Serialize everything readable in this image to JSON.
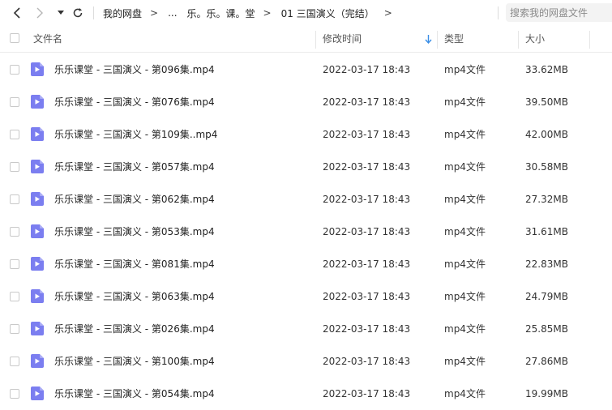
{
  "toolbar": {
    "back_icon": "chevron-left-icon",
    "forward_icon": "chevron-right-icon",
    "history_icon": "caret-down-icon",
    "refresh_icon": "refresh-icon"
  },
  "breadcrumb": {
    "items": [
      "我的网盘",
      "...",
      "乐。乐。课。堂",
      "01 三国演义（完结）"
    ],
    "separator": ">"
  },
  "search": {
    "placeholder": "搜索我的网盘文件"
  },
  "table": {
    "columns": {
      "name": "文件名",
      "time": "修改时间",
      "type": "类型",
      "size": "大小"
    },
    "sort_indicator": "↓",
    "rows": [
      {
        "name": "乐乐课堂 - 三国演义 - 第096集.mp4",
        "time": "2022-03-17 18:43",
        "type": "mp4文件",
        "size": "33.62MB"
      },
      {
        "name": "乐乐课堂 - 三国演义 - 第076集.mp4",
        "time": "2022-03-17 18:43",
        "type": "mp4文件",
        "size": "39.50MB"
      },
      {
        "name": "乐乐课堂 - 三国演义 - 第109集..mp4",
        "time": "2022-03-17 18:43",
        "type": "mp4文件",
        "size": "42.00MB"
      },
      {
        "name": "乐乐课堂 - 三国演义 - 第057集.mp4",
        "time": "2022-03-17 18:43",
        "type": "mp4文件",
        "size": "30.58MB"
      },
      {
        "name": "乐乐课堂 - 三国演义 - 第062集.mp4",
        "time": "2022-03-17 18:43",
        "type": "mp4文件",
        "size": "27.32MB"
      },
      {
        "name": "乐乐课堂 - 三国演义 - 第053集.mp4",
        "time": "2022-03-17 18:43",
        "type": "mp4文件",
        "size": "31.61MB"
      },
      {
        "name": "乐乐课堂 - 三国演义 - 第081集.mp4",
        "time": "2022-03-17 18:43",
        "type": "mp4文件",
        "size": "22.83MB"
      },
      {
        "name": "乐乐课堂 - 三国演义 - 第063集.mp4",
        "time": "2022-03-17 18:43",
        "type": "mp4文件",
        "size": "24.79MB"
      },
      {
        "name": "乐乐课堂 - 三国演义 - 第026集.mp4",
        "time": "2022-03-17 18:43",
        "type": "mp4文件",
        "size": "25.85MB"
      },
      {
        "name": "乐乐课堂 - 三国演义 - 第100集.mp4",
        "time": "2022-03-17 18:43",
        "type": "mp4文件",
        "size": "27.86MB"
      },
      {
        "name": "乐乐课堂 - 三国演义 - 第054集.mp4",
        "time": "2022-03-17 18:43",
        "type": "mp4文件",
        "size": "19.99MB"
      }
    ]
  },
  "colors": {
    "accent": "#3a8ee6",
    "video_icon": "#7b7ef0"
  },
  "file_icon": "video-file-icon"
}
